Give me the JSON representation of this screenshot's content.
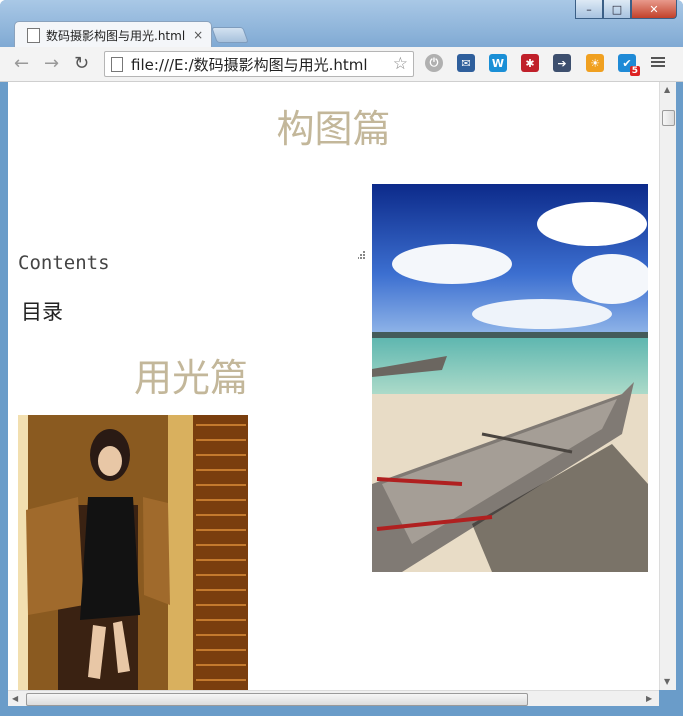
{
  "browser": {
    "tab_title": "数码摄影构图与用光.html",
    "tab_close": "×",
    "address": "file:///E:/数码摄影构图与用光.html",
    "win_minimize": "–",
    "win_maximize": "□",
    "win_close": "✕",
    "extensions": [
      {
        "icon": "mail-icon",
        "color": "#2f5f9c",
        "glyph": "✉"
      },
      {
        "icon": "w-icon",
        "color": "#1a8fd6",
        "glyph": "W"
      },
      {
        "icon": "asterisk-icon",
        "color": "#c0202a",
        "glyph": "✱"
      },
      {
        "icon": "share-icon",
        "color": "#3d4f6e",
        "glyph": "➔"
      },
      {
        "icon": "weather-icon",
        "color": "#f0a020",
        "glyph": "☀"
      },
      {
        "icon": "check-icon",
        "color": "#1f8ad6",
        "glyph": "✔",
        "badge": "5"
      }
    ]
  },
  "page": {
    "heading_composition": "构图篇",
    "contents_label": "Contents",
    "toc_label": "目录",
    "heading_lighting": "用光篇"
  },
  "colors": {
    "heading": "#c3b79a"
  }
}
